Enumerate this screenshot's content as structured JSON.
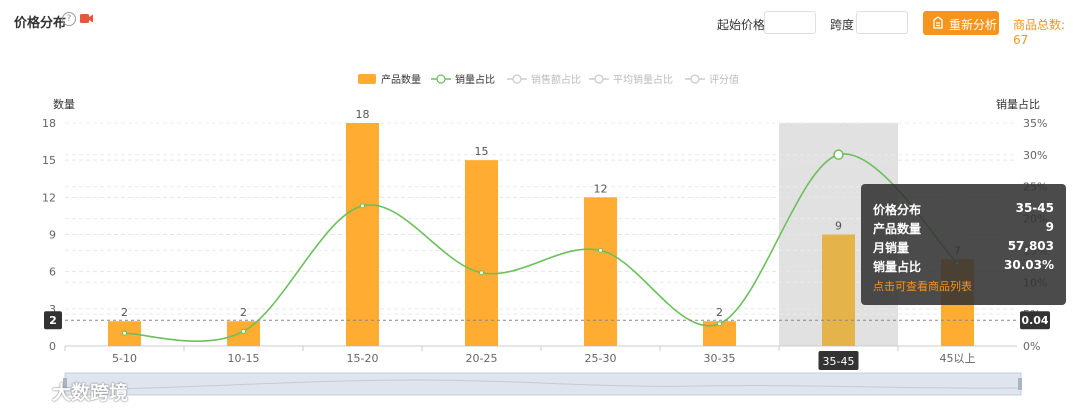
{
  "header": {
    "title": "价格分布",
    "start_price_label": "起始价格",
    "start_price_value": "",
    "span_label": "跨度",
    "span_value": "",
    "reanalyze_label": "重新分析",
    "total_label": "商品总数: 67"
  },
  "colors": {
    "accent": "#f7941d",
    "bar": "#ffac33",
    "line": "#6cc05c",
    "tooltip_bg": "#323232"
  },
  "chart_data": {
    "type": "bar",
    "categories": [
      "5-10",
      "10-15",
      "15-20",
      "20-25",
      "25-30",
      "30-35",
      "35-45",
      "45以上"
    ],
    "legend": [
      "产品数量",
      "销量占比",
      "销售额占比",
      "平均销量占比",
      "评分值"
    ],
    "y_left_label": "数量",
    "y_right_label": "销量占比",
    "y_left_ticks": [
      "0",
      "3",
      "6",
      "9",
      "12",
      "15",
      "18"
    ],
    "y_right_ticks": [
      "0%",
      "5%",
      "10%",
      "15%",
      "20%",
      "25%",
      "30%",
      "35%"
    ],
    "ylim_left": [
      0,
      18
    ],
    "ylim_right": [
      0,
      35
    ],
    "series": [
      {
        "name": "产品数量",
        "type": "bar",
        "values": [
          2,
          2,
          18,
          15,
          12,
          2,
          9,
          7
        ],
        "labels": [
          "2",
          "2",
          "18",
          "15",
          "12",
          "2",
          "9",
          "7"
        ]
      },
      {
        "name": "销量占比",
        "type": "line",
        "smooth": true,
        "values": [
          2.0,
          2.3,
          22.0,
          11.5,
          15.0,
          3.5,
          30.03,
          13.0
        ]
      }
    ],
    "highlight_index": 6,
    "crosshair": {
      "left_value": "2",
      "right_value": "0.04"
    }
  },
  "tooltip": {
    "rows": [
      {
        "key": "价格分布",
        "value": "35-45"
      },
      {
        "key": "产品数量",
        "value": "9"
      },
      {
        "key": "月销量",
        "value": "57,803"
      },
      {
        "key": "销量占比",
        "value": "30.03%"
      }
    ],
    "link": "点击可查看商品列表"
  },
  "watermark": "大数跨境"
}
